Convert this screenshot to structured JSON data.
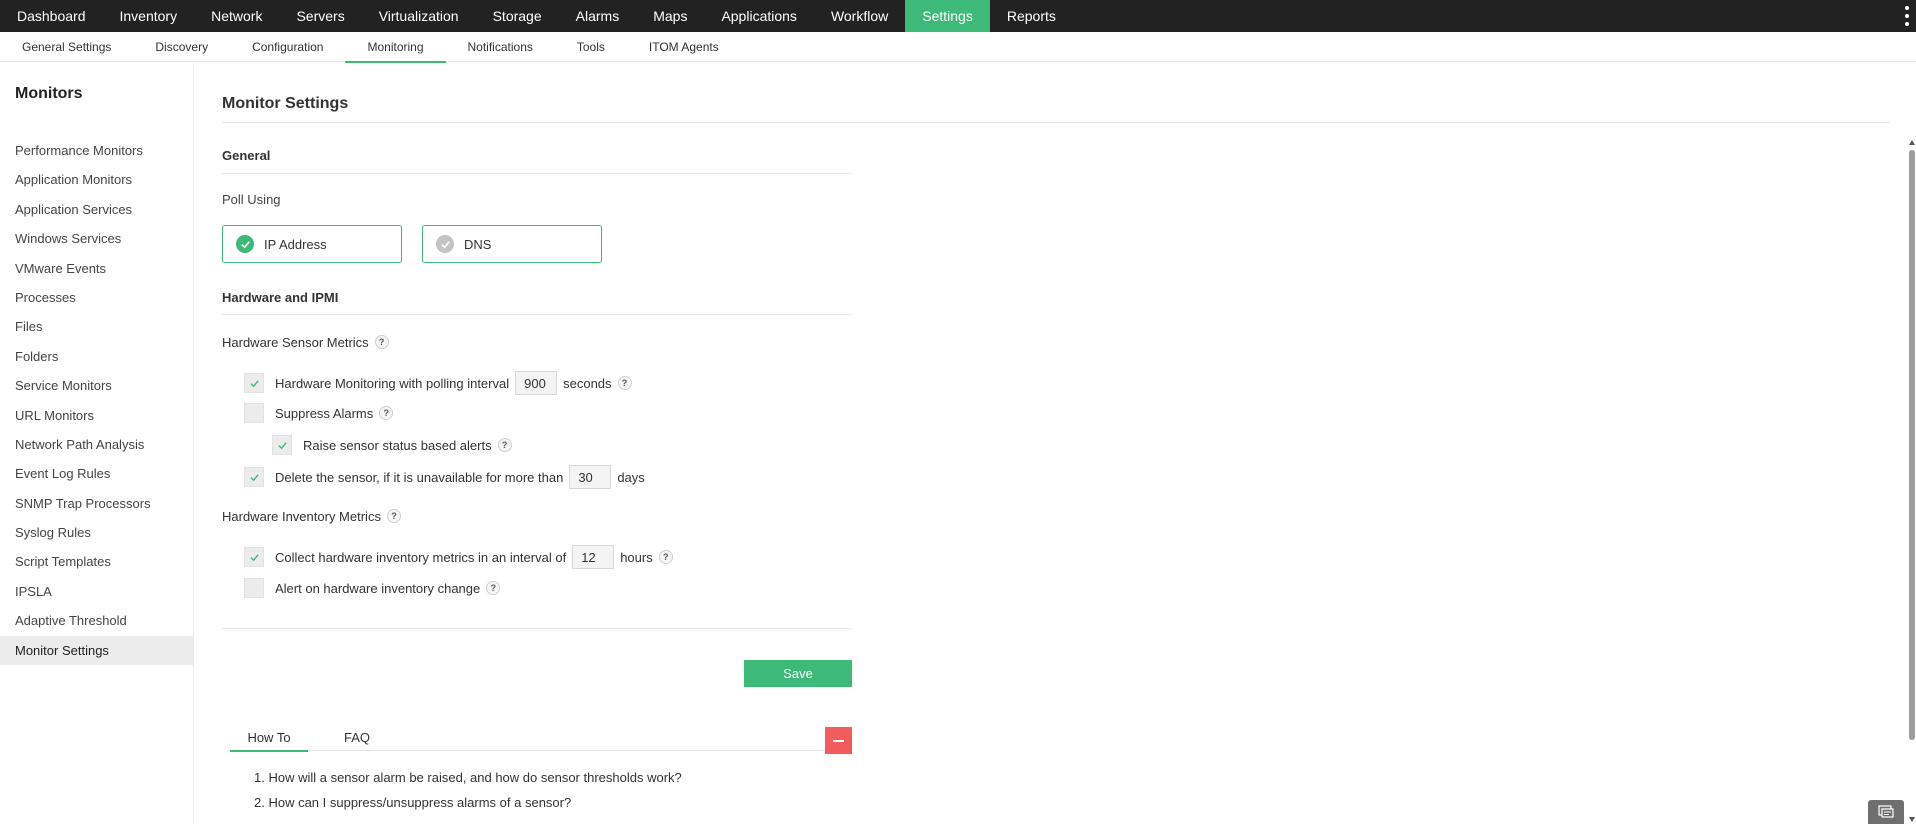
{
  "topnav": {
    "items": [
      "Dashboard",
      "Inventory",
      "Network",
      "Servers",
      "Virtualization",
      "Storage",
      "Alarms",
      "Maps",
      "Applications",
      "Workflow",
      "Settings",
      "Reports"
    ],
    "active": "Settings"
  },
  "subnav": {
    "items": [
      "General Settings",
      "Discovery",
      "Configuration",
      "Monitoring",
      "Notifications",
      "Tools",
      "ITOM Agents"
    ],
    "active": "Monitoring"
  },
  "sidebar": {
    "title": "Monitors",
    "items": [
      "Performance Monitors",
      "Application Monitors",
      "Application Services",
      "Windows Services",
      "VMware Events",
      "Processes",
      "Files",
      "Folders",
      "Service Monitors",
      "URL Monitors",
      "Network Path Analysis",
      "Event Log Rules",
      "SNMP Trap Processors",
      "Syslog Rules",
      "Script Templates",
      "IPSLA",
      "Adaptive Threshold",
      "Monitor Settings"
    ],
    "active": "Monitor Settings"
  },
  "main": {
    "title": "Monitor Settings",
    "general": {
      "heading": "General",
      "poll_label": "Poll Using",
      "options": [
        {
          "label": "IP Address",
          "selected": true
        },
        {
          "label": "DNS",
          "selected": false
        }
      ]
    },
    "hardware": {
      "heading": "Hardware and IPMI",
      "sensor_label": "Hardware Sensor Metrics",
      "hw_monitoring": {
        "checked": true,
        "label": "Hardware Monitoring with polling interval",
        "value": "900",
        "unit": "seconds"
      },
      "suppress_alarms": {
        "checked": false,
        "label": "Suppress Alarms"
      },
      "raise_sensor": {
        "checked": true,
        "label": "Raise sensor status based alerts"
      },
      "delete_sensor": {
        "checked": true,
        "label": "Delete the sensor, if it is unavailable for more than",
        "value": "30",
        "unit": "days"
      },
      "inventory_label": "Hardware Inventory Metrics",
      "collect_inventory": {
        "checked": true,
        "label": "Collect hardware inventory metrics in an interval of",
        "value": "12",
        "unit": "hours"
      },
      "alert_inventory": {
        "checked": false,
        "label": "Alert on hardware inventory change"
      }
    },
    "save_label": "Save",
    "help_glyph": "?"
  },
  "help_panel": {
    "tabs": [
      "How To",
      "FAQ"
    ],
    "active_tab": "How To",
    "howto": [
      "1. How will a sensor alarm be raised, and how do sensor thresholds work?",
      "2. How can I suppress/unsuppress alarms of a sensor?"
    ]
  },
  "colors": {
    "accent": "#3dba78",
    "topnav_bg": "#222222",
    "collapse_btn": "#f25c5c"
  }
}
